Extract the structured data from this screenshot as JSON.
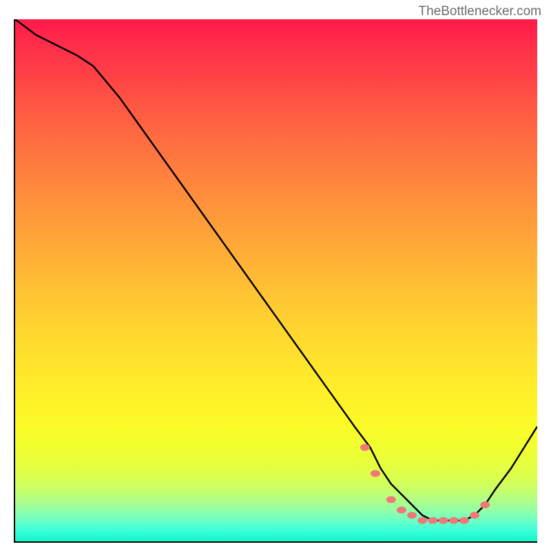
{
  "watermark": "TheBottlenecker.com",
  "chart_data": {
    "type": "line",
    "title": "",
    "xlabel": "",
    "ylabel": "",
    "xlim": [
      0,
      100
    ],
    "ylim": [
      0,
      100
    ],
    "series": [
      {
        "name": "bottleneck-curve",
        "x": [
          0,
          4,
          8,
          12,
          15,
          20,
          25,
          30,
          35,
          40,
          45,
          50,
          55,
          60,
          65,
          68,
          70,
          72,
          74,
          76,
          78,
          80,
          82,
          84,
          86,
          88,
          90,
          92,
          95,
          100
        ],
        "y": [
          100,
          97,
          95,
          93,
          91,
          85,
          78,
          71,
          64,
          57,
          50,
          43,
          36,
          29,
          22,
          18,
          14,
          11,
          9,
          7,
          5,
          4,
          4,
          4,
          4,
          5,
          7,
          10,
          14,
          22
        ]
      }
    ],
    "markers": {
      "name": "optimal-range-dots",
      "x": [
        67,
        69,
        72,
        74,
        76,
        78,
        80,
        82,
        84,
        86,
        88,
        90
      ],
      "y": [
        18,
        13,
        8,
        6,
        5,
        4,
        4,
        4,
        4,
        4,
        5,
        7
      ]
    },
    "gradient": {
      "top_color": "#ff1a4a",
      "mid_color": "#ffe22d",
      "bottom_color": "#12f5c5"
    }
  }
}
